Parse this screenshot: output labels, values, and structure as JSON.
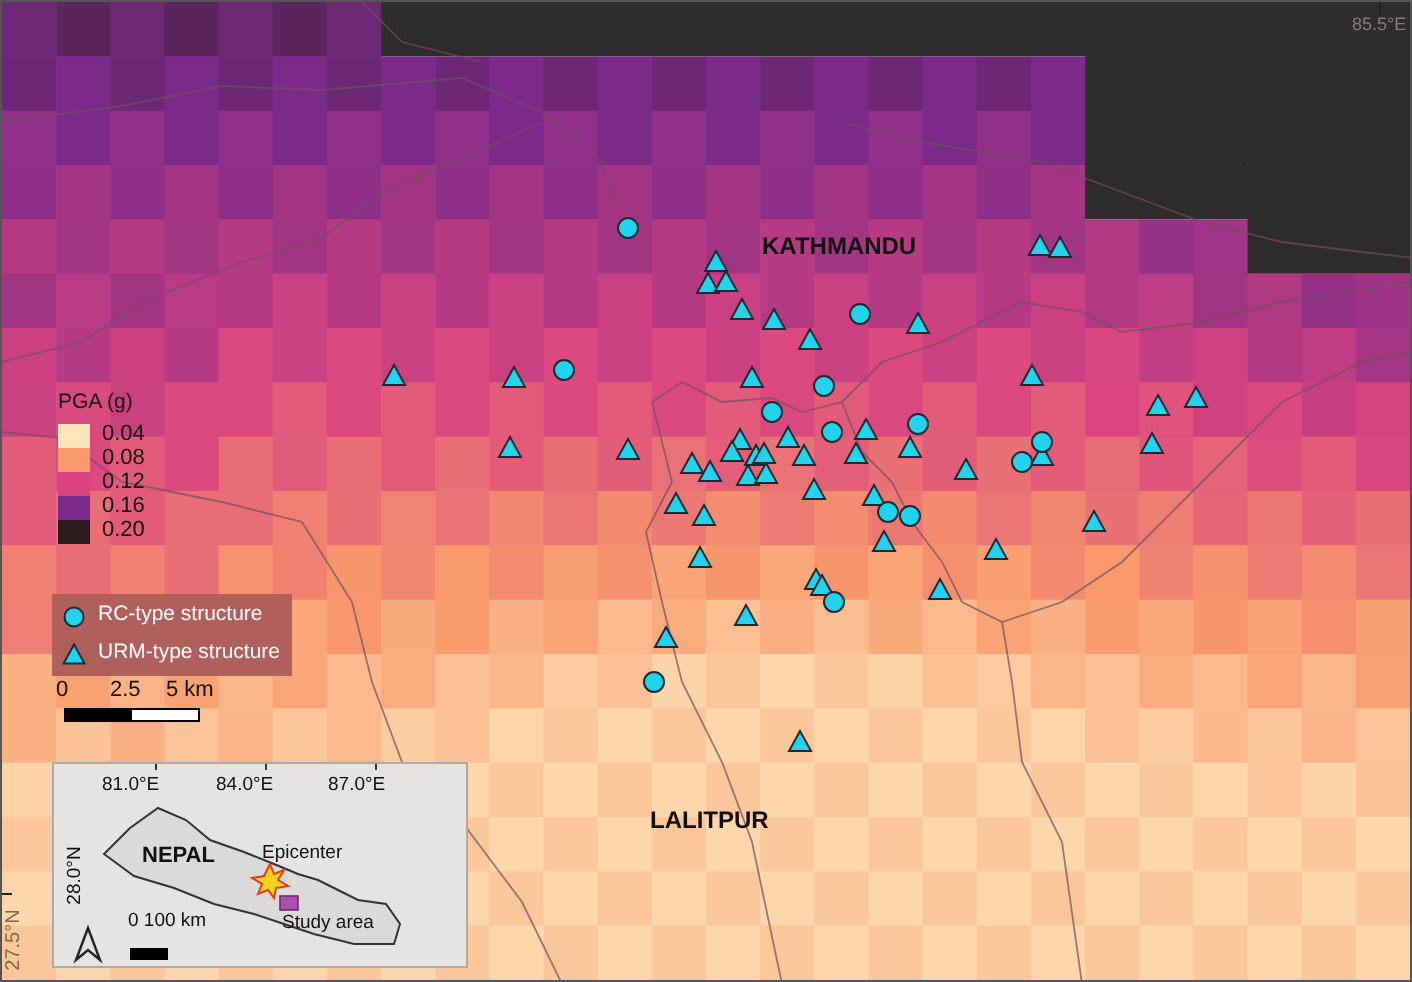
{
  "map": {
    "place_labels": [
      {
        "text": "KATHMANDU"
      },
      {
        "text": "LALITPUR"
      }
    ],
    "coordinate_labels": [
      {
        "text": "85.5°E"
      },
      {
        "text": "27.5°N"
      }
    ]
  },
  "pga_legend": {
    "title": "PGA (g)",
    "items": [
      {
        "label": "0.04",
        "color": "#fde6bb"
      },
      {
        "label": "0.08",
        "color": "#f99a6c"
      },
      {
        "label": "0.12",
        "color": "#d9447f"
      },
      {
        "label": "0.16",
        "color": "#7b2a8a"
      },
      {
        "label": "0.20",
        "color": "#2d1c1e"
      }
    ]
  },
  "structure_legend": [
    {
      "kind": "circle",
      "label": "RC-type structure"
    },
    {
      "kind": "triangle",
      "label": "URM-type structure"
    }
  ],
  "scale_bar": {
    "labels": [
      "0",
      "2.5",
      "5 km"
    ]
  },
  "inset": {
    "longitude_labels": [
      "81.0°E",
      "84.0°E",
      "87.0°E"
    ],
    "latitude_label": "28.0°N",
    "country_label": "NEPAL",
    "epicenter_label": "Epicenter",
    "study_area_label": "Study area",
    "scale_label": "0 100 km"
  }
}
